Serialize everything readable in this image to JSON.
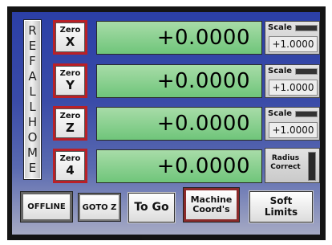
{
  "ref_all_home": {
    "letters": [
      "R",
      "E",
      "F",
      "A",
      "L",
      "L",
      "H",
      "O",
      "M",
      "E"
    ]
  },
  "axes": [
    {
      "zero_label": "Zero",
      "axis": "X",
      "dro_value": "+0.0000",
      "scale_title": "Scale",
      "scale_value": "+1.0000"
    },
    {
      "zero_label": "Zero",
      "axis": "Y",
      "dro_value": "+0.0000",
      "scale_title": "Scale",
      "scale_value": "+1.0000"
    },
    {
      "zero_label": "Zero",
      "axis": "Z",
      "dro_value": "+0.0000",
      "scale_title": "Scale",
      "scale_value": "+1.0000"
    },
    {
      "zero_label": "Zero",
      "axis": "4",
      "dro_value": "+0.0000"
    }
  ],
  "radius_correct": {
    "label": "Radius\nCorrect"
  },
  "buttons": {
    "offline": "OFFLINE",
    "goto_z": "GOTO Z",
    "to_go": "To Go",
    "machine_coords": "Machine\nCoord's",
    "soft_limits": "Soft\nLimits"
  },
  "colors": {
    "panel_top": "#2b3fa6",
    "panel_bottom": "#a6aac4",
    "dro_green": "#6fc57a",
    "zero_border_red": "#b92027"
  }
}
